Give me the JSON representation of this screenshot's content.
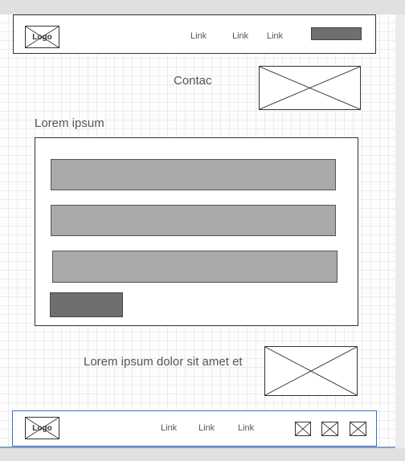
{
  "header": {
    "logo_label": "Logo",
    "nav": [
      "Link",
      "Link",
      "Link"
    ]
  },
  "contact": {
    "title": "Contac"
  },
  "form": {
    "heading": "Lorem ipsum",
    "fields_count": 3
  },
  "promo": {
    "text": "Lorem ipsum dolor sit amet et"
  },
  "footer": {
    "logo_label": "Logo",
    "nav": [
      "Link",
      "Link",
      "Link"
    ],
    "social_icons": [
      "image-placeholder-icon",
      "image-placeholder-icon",
      "image-placeholder-icon"
    ]
  }
}
